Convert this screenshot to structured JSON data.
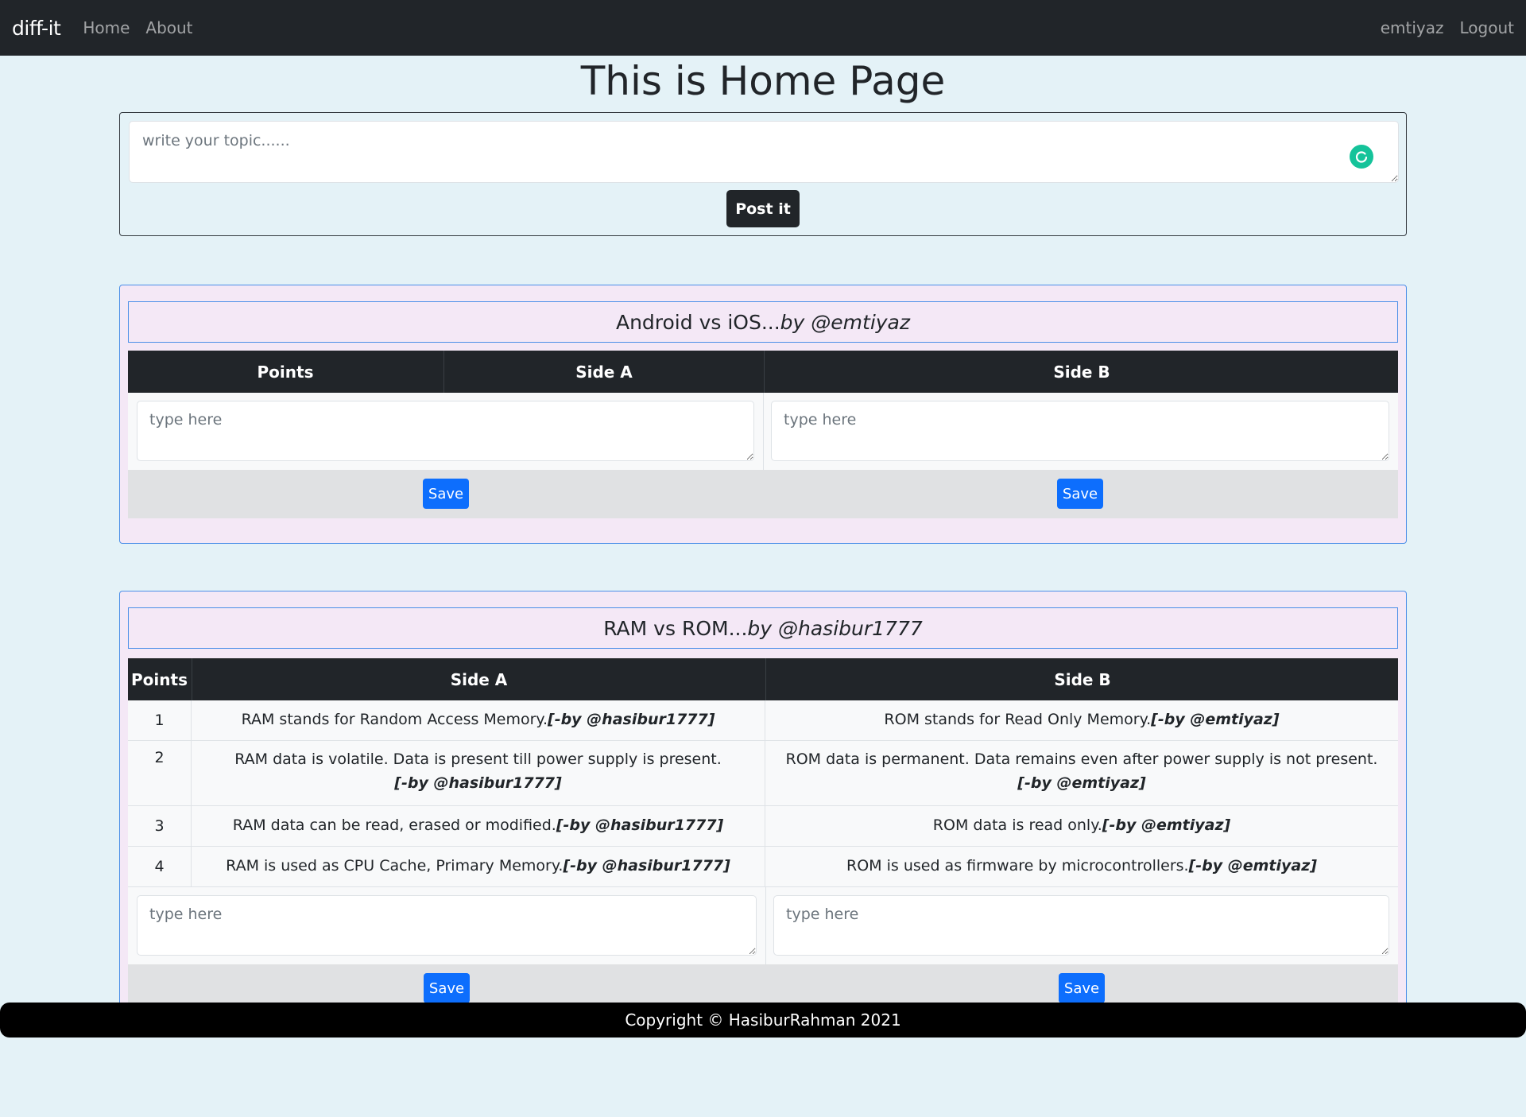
{
  "nav": {
    "brand": "diff-it",
    "home": "Home",
    "about": "About",
    "user": "emtiyaz",
    "logout": "Logout"
  },
  "page_title": "This is Home Page",
  "post": {
    "placeholder": "write your topic......",
    "button": "Post it"
  },
  "topics": [
    {
      "title": "Android vs iOS...",
      "by": "by @emtiyaz",
      "headers": [
        "Points",
        "Side A",
        "Side B"
      ],
      "input_placeholder_a": "type here",
      "input_placeholder_b": "type here",
      "save_a": "Save",
      "save_b": "Save"
    },
    {
      "title": "RAM vs ROM...",
      "by": "by @hasibur1777",
      "headers": [
        "Points",
        "Side A",
        "Side B"
      ],
      "rows": [
        {
          "num": "1",
          "a": "RAM stands for Random Access Memory.",
          "a_by": "[-by @hasibur1777]",
          "b": "ROM stands for Read Only Memory.",
          "b_by": "[-by @emtiyaz]"
        },
        {
          "num": "2",
          "a": "RAM data is volatile. Data is present till power supply is present.",
          "a_by": "[-by @hasibur1777]",
          "b": "ROM data is permanent. Data remains even after power supply is not present.",
          "b_by": "[-by @emtiyaz]"
        },
        {
          "num": "3",
          "a": "RAM data can be read, erased or modified.",
          "a_by": "[-by @hasibur1777]",
          "b": "ROM data is read only.",
          "b_by": "[-by @emtiyaz]"
        },
        {
          "num": "4",
          "a": "RAM is used as CPU Cache, Primary Memory.",
          "a_by": "[-by @hasibur1777]",
          "b": "ROM is used as firmware by microcontrollers.",
          "b_by": "[-by @emtiyaz]"
        }
      ],
      "input_placeholder_a": "type here",
      "input_placeholder_b": "type here",
      "save_a": "Save",
      "save_b": "Save"
    }
  ],
  "footer": "Copyright © HasiburRahman 2021",
  "colors": {
    "navbar": "#212529",
    "page_bg": "#e4f2f7",
    "card_bg": "#f4e8f6",
    "card_border": "#4b8fe8",
    "primary": "#0d6efd",
    "grammarly": "#15c39a"
  }
}
